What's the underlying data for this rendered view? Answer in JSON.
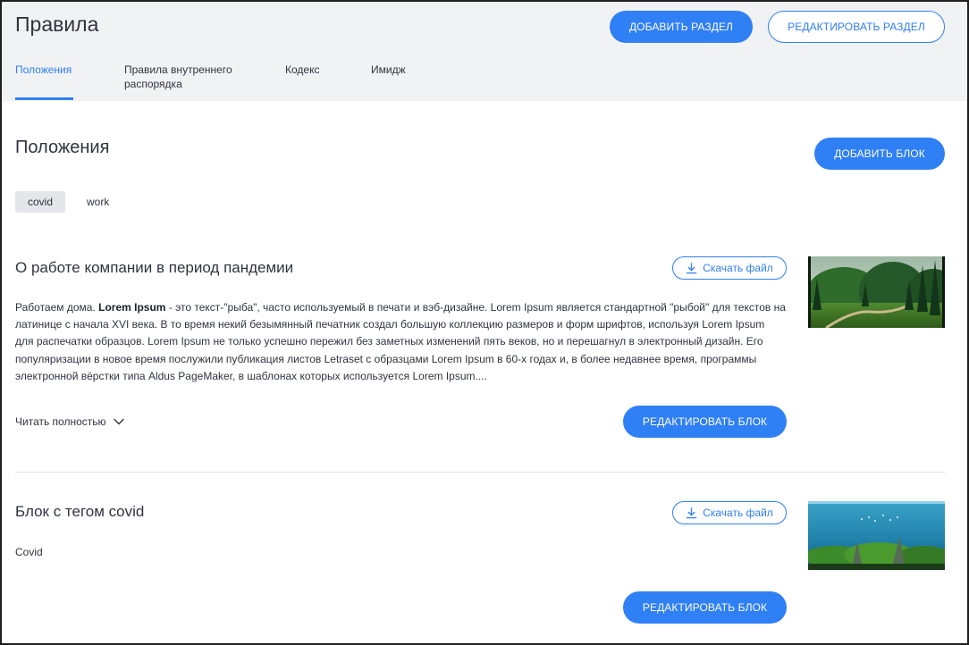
{
  "header": {
    "title": "Правила",
    "add_section_label": "ДОБАВИТЬ РАЗДЕЛ",
    "edit_section_label": "РЕДАКТИРОВАТЬ РАЗДЕЛ",
    "tabs": [
      {
        "label": "Положения",
        "active": true
      },
      {
        "label": "Правила внутреннего распорядка",
        "active": false
      },
      {
        "label": "Кодекс",
        "active": false
      },
      {
        "label": "Имидж",
        "active": false
      }
    ]
  },
  "section": {
    "title": "Положения",
    "add_block_label": "ДОБАВИТЬ БЛОК",
    "tags": [
      {
        "label": "covid",
        "active": true
      },
      {
        "label": "work",
        "active": false
      }
    ]
  },
  "blocks": [
    {
      "title": "О работе компании в период пандемии",
      "download_label": "Скачать файл",
      "text_intro": "Работаем дома. ",
      "text_bold": "Lorem Ipsum",
      "text_rest": " - это текст-\"рыба\", часто используемый в печати и вэб-дизайне. Lorem Ipsum является стандартной \"рыбой\" для текстов на латинице с начала XVI века. В то время некий безымянный печатник создал большую коллекцию размеров и форм шрифтов, используя Lorem Ipsum для распечатки образцов. Lorem Ipsum не только успешно пережил без заметных изменений пять веков, но и перешагнул в электронный дизайн. Его популяризации в новое время послужили публикация листов Letraset с образцами Lorem Ipsum в 60-х годах и, в более недавнее время, программы электронной вёрстки типа Aldus PageMaker, в шаблонах которых используется Lorem Ipsum....",
      "read_more_label": "Читать полностью",
      "edit_label": "РЕДАКТИРОВАТЬ БЛОК"
    },
    {
      "title": "Блок с тегом covid",
      "download_label": "Скачать файл",
      "text": "Covid",
      "edit_label": "РЕДАКТИРОВАТЬ БЛОК"
    }
  ],
  "colors": {
    "accent": "#2f7ff5",
    "header_bg": "#f1f2f4",
    "text": "#2f3440"
  },
  "icons": {
    "download": "download-icon",
    "chevron": "chevron-down-icon"
  }
}
